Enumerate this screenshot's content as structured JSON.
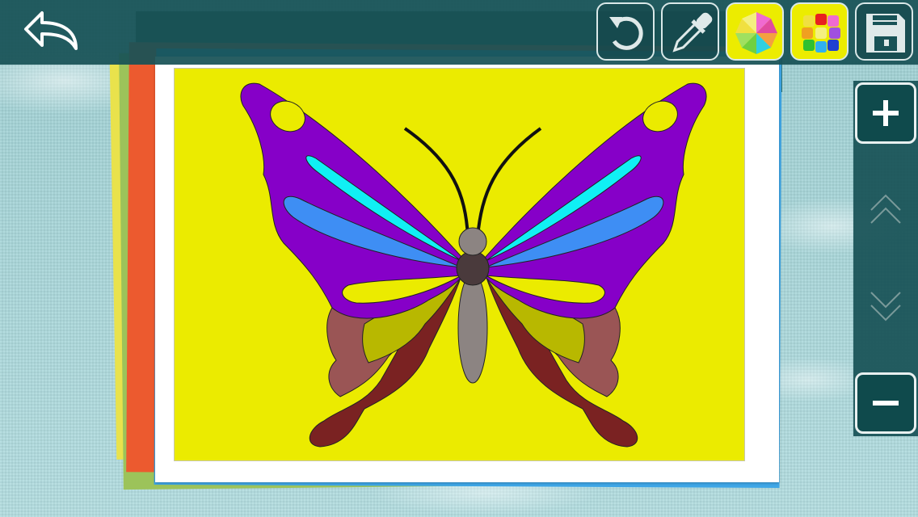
{
  "app": {
    "screen": "coloring-canvas"
  },
  "toolbar": {
    "back_icon": "back-arrow-icon",
    "undo_icon": "undo-icon",
    "eyedropper_icon": "eyedropper-icon",
    "fill_palette_icon": "pinwheel-palette-icon",
    "color_grid_icon": "color-grid-icon",
    "save_icon": "floppy-disk-icon"
  },
  "zoom": {
    "zoom_in_icon": "plus-icon",
    "scroll_up_icon": "double-chevron-up-icon",
    "scroll_down_icon": "double-chevron-down-icon",
    "zoom_out_icon": "minus-icon"
  },
  "colors": {
    "topbar": "#185256",
    "canvas_background": "#ebeb00",
    "upper_wing": "#8600c8",
    "wing_stripe_cyan": "#10f0f4",
    "wing_stripe_blue": "#3e8ef4",
    "wing_spot": "#ebeb00",
    "lower_wing_rose": "#9a5555",
    "lower_wing_olive": "#b8b800",
    "lower_wing_maroon": "#7a2222",
    "body_gray": "#8c8482",
    "thorax": "#4a3a3c",
    "antennae": "#111111"
  },
  "picture": {
    "subject": "butterfly"
  }
}
